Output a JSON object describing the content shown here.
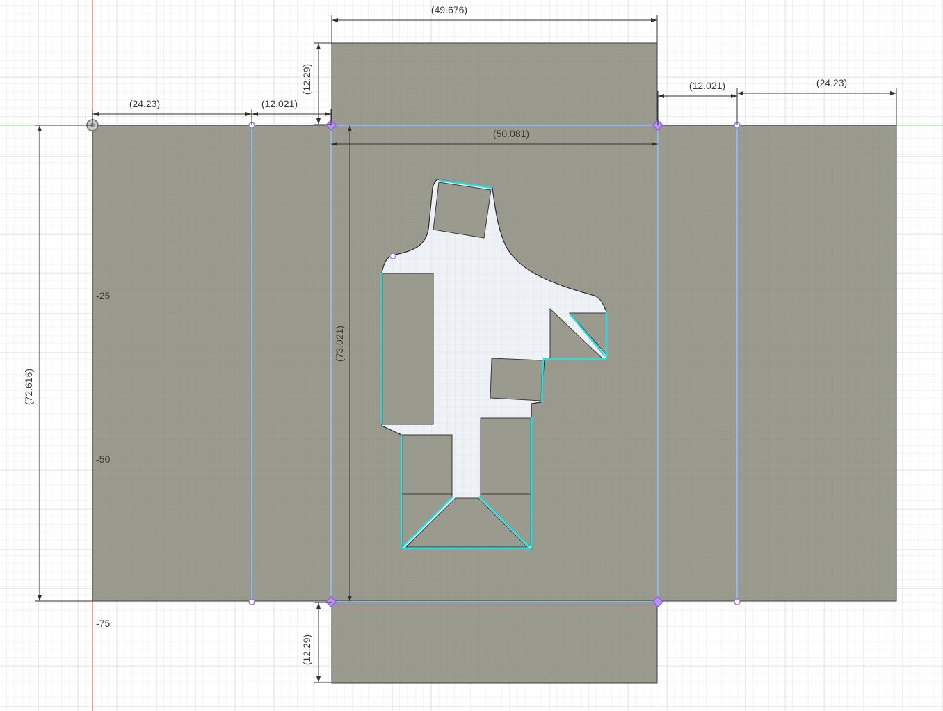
{
  "viewport": {
    "colors": {
      "background": "#ffffff",
      "grid_minor": "#e6e8ec",
      "grid_major": "#d2d6dc",
      "body": "#9a9b8e",
      "cutout": "#eef1f5",
      "x_axis": "#7bd97b",
      "y_axis": "#ec5a5a",
      "sketch_line": "#8fb8f0",
      "constrained_line": "#23e0e0",
      "sketch_point": "#9e79e8"
    }
  },
  "axis_labels": {
    "y_minus_25": "-25",
    "y_minus_50": "-50",
    "y_minus_75": "-75"
  },
  "dimensions": {
    "top_flap_width": "(49.676)",
    "top_flap_height": "(12.29)",
    "bottom_flap_height": "(12.29)",
    "left_panel_width": "(24.23)",
    "left_hinge_width": "(12.021)",
    "right_hinge_width": "(12.021)",
    "right_panel_width": "(24.23)",
    "center_width": "(50.081)",
    "center_height": "(73.021)",
    "overall_height": "(72.616)"
  }
}
